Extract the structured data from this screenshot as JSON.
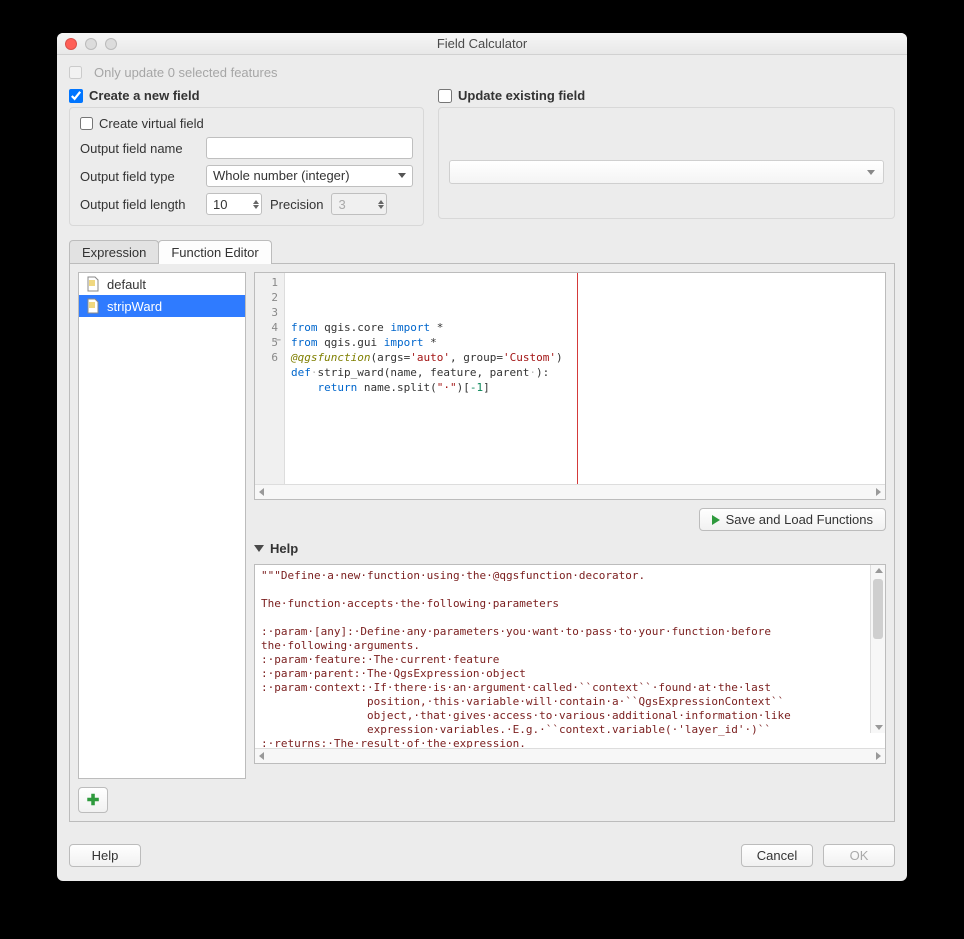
{
  "window": {
    "title": "Field Calculator"
  },
  "top": {
    "only_update": "Only update 0 selected features",
    "create_new": "Create a new field",
    "update_existing": "Update existing field"
  },
  "new_field": {
    "virtual_label": "Create virtual field",
    "name_label": "Output field name",
    "type_label": "Output field type",
    "type_value": "Whole number (integer)",
    "length_label": "Output field length",
    "length_value": "10",
    "precision_label": "Precision",
    "precision_value": "3"
  },
  "tabs": {
    "expression": "Expression",
    "function_editor": "Function Editor"
  },
  "func_list": {
    "items": [
      "default",
      "stripWard"
    ],
    "selected": "stripWard"
  },
  "code": {
    "lines": [
      {
        "n": 1,
        "html": "<span class='kw'>from</span> qgis.core <span class='kw'>import</span> *"
      },
      {
        "n": 2,
        "html": "<span class='kw'>from</span> qgis.gui <span class='kw'>import</span> *"
      },
      {
        "n": 3,
        "html": ""
      },
      {
        "n": 4,
        "html": "<span class='dec'>@qgsfunction</span>(args=<span class='str'>'auto'</span>, group=<span class='str'>'Custom'</span>)"
      },
      {
        "n": 5,
        "html": "<span class='kw'>def</span><span class='dots'>·</span>strip_ward(name, feature, parent<span class='dots'>·</span>):"
      },
      {
        "n": 6,
        "html": "    <span class='kw'>return</span> name.split(<span class='str'>\"·\"</span>)[<span class='num'>-1</span>]"
      }
    ]
  },
  "buttons": {
    "save_load": "Save and Load Functions",
    "help_header": "Help",
    "help": "Help",
    "cancel": "Cancel",
    "ok": "OK"
  },
  "help": {
    "text": "\"\"\"Define·a·new·function·using·the·@qgsfunction·decorator.\n\nThe·function·accepts·the·following·parameters\n\n:·param·[any]:·Define·any·parameters·you·want·to·pass·to·your·function·before\nthe·following·arguments.\n:·param·feature:·The·current·feature\n:·param·parent:·The·QgsExpression·object\n:·param·context:·If·there·is·an·argument·called·``context``·found·at·the·last\n                position,·this·variable·will·contain·a·``QgsExpressionContext``\n                object,·that·gives·access·to·various·additional·information·like\n                expression·variables.·E.g.·``context.variable(·'layer_id'·)``\n:·returns:·The·result·of·the·expression.\n\n"
  }
}
